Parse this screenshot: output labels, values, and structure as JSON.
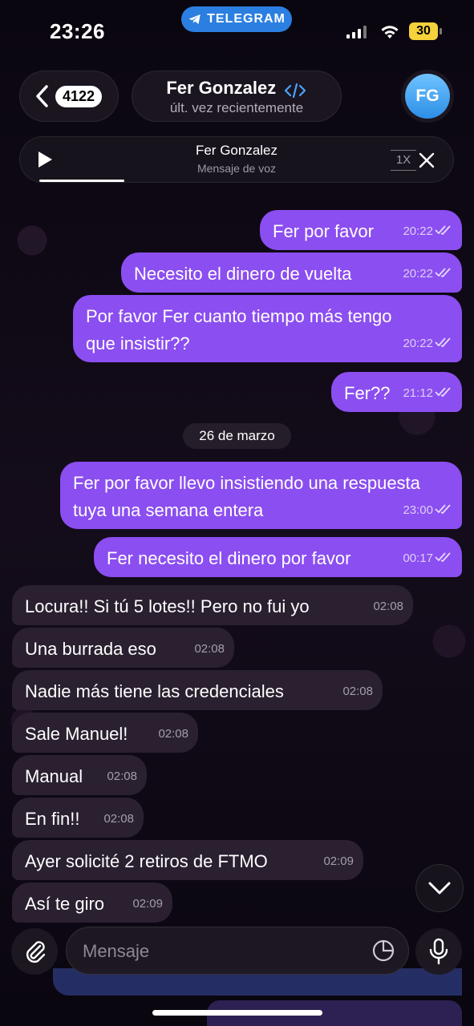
{
  "status_bar": {
    "time": "23:26",
    "app_pill": "TELEGRAM",
    "battery": "30"
  },
  "header": {
    "back_count": "4122",
    "contact_name": "Fer Gonzalez",
    "contact_status": "últ. vez recientemente",
    "avatar_initials": "FG"
  },
  "voice_player": {
    "title": "Fer Gonzalez",
    "subtitle": "Mensaje de voz",
    "speed": "1X"
  },
  "date_divider": "26 de marzo",
  "messages": [
    {
      "dir": "out",
      "text": "Fer por favor",
      "time": "20:22"
    },
    {
      "dir": "out",
      "text": "Necesito el dinero de vuelta",
      "time": "20:22"
    },
    {
      "dir": "out",
      "text": "Por favor Fer cuanto tiempo más tengo que insistir??",
      "time": "20:22"
    },
    {
      "dir": "out",
      "text": "Fer??",
      "time": "21:12"
    },
    {
      "dir": "out",
      "text": "Fer por favor llevo insistiendo una respuesta tuya una semana entera",
      "time": "23:00"
    },
    {
      "dir": "out",
      "text": "Fer necesito el dinero por favor",
      "time": "00:17"
    },
    {
      "dir": "in",
      "text": "Locura!! Si tú 5 lotes!! Pero no fui yo",
      "time": "02:08"
    },
    {
      "dir": "in",
      "text": "Una burrada eso",
      "time": "02:08"
    },
    {
      "dir": "in",
      "text": "Nadie más tiene las credenciales",
      "time": "02:08"
    },
    {
      "dir": "in",
      "text": "Sale Manuel!",
      "time": "02:08"
    },
    {
      "dir": "in",
      "text": "Manual",
      "time": "02:08"
    },
    {
      "dir": "in",
      "text": "En fin!!",
      "time": "02:08"
    },
    {
      "dir": "in",
      "text": "Ayer solicité 2 retiros de FTMO",
      "time": "02:09"
    },
    {
      "dir": "in",
      "text": "Así te giro",
      "time": "02:09"
    }
  ],
  "composer": {
    "placeholder": "Mensaje"
  },
  "colors": {
    "outgoing": "#8b4ef0",
    "incoming": "#2a2030",
    "accent": "#2b7fe0"
  }
}
